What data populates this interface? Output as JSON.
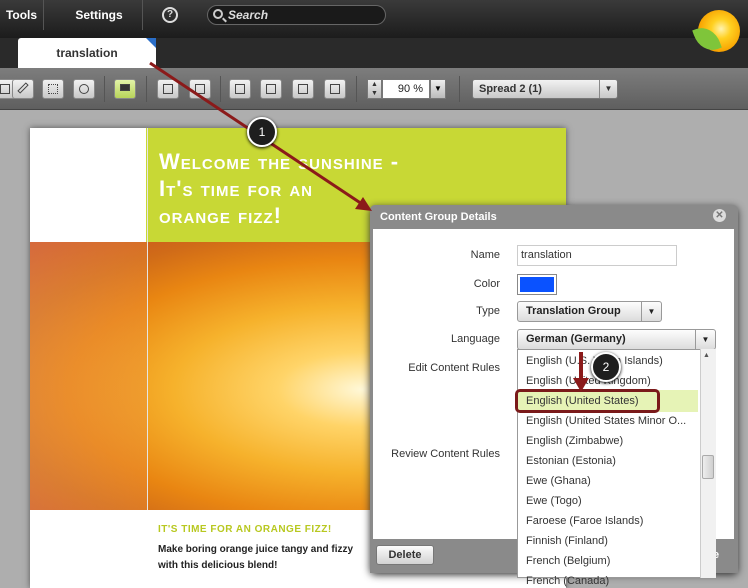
{
  "menu": {
    "tools": "Tools",
    "settings": "Settings",
    "help": "?"
  },
  "search": {
    "placeholder": "Search"
  },
  "tab": {
    "label": "translation"
  },
  "toolbar": {
    "zoom": "90 %",
    "spread": "Spread 2 (1)"
  },
  "page": {
    "headline1": "Welcome the sunshine -",
    "headline2": "It's time for an",
    "headline3": "orange fizz!",
    "subhead": "IT'S TIME FOR AN ORANGE FIZZ!",
    "body1": "Make boring orange juice tangy and fizzy",
    "body2": "with this delicious blend!"
  },
  "dialog": {
    "title": "Content Group Details",
    "name_label": "Name",
    "name_value": "translation",
    "color_label": "Color",
    "color_value": "#0a52ff",
    "type_label": "Type",
    "type_value": "Translation Group",
    "language_label": "Language",
    "language_value": "German (Germany)",
    "edit_rules_label": "Edit Content Rules",
    "review_rules_label": "Review Content Rules",
    "delete_label": "Delete",
    "partial_button": "e",
    "languages": [
      "English (U.S. Virgin Islands)",
      "English (United Kingdom)",
      "English (United States)",
      "English (United States Minor O...",
      "English (Zimbabwe)",
      "Estonian (Estonia)",
      "Ewe (Ghana)",
      "Ewe (Togo)",
      "Faroese (Faroe Islands)",
      "Finnish (Finland)",
      "French (Belgium)",
      "French (Canada)"
    ],
    "selected_language": "English (United States)"
  },
  "annotations": {
    "step1": "1",
    "step2": "2"
  },
  "colors": {
    "accent_green": "#c8d835",
    "selection_outline": "#7a1a1a",
    "arrow": "#8b1a1a"
  }
}
